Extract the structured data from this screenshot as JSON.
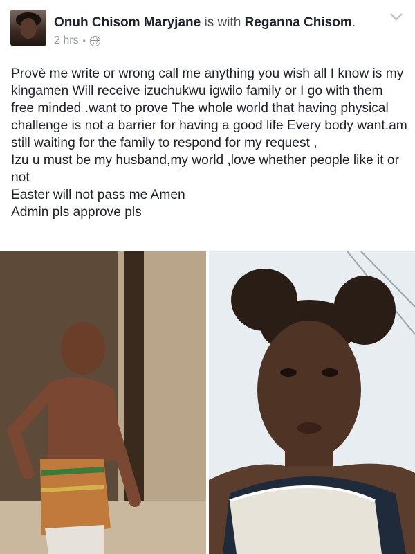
{
  "post": {
    "author": "Onuh Chisom Maryjane",
    "with_word": "is with",
    "tagged": "Reganna Chisom",
    "period": ".",
    "time": "2 hrs",
    "separator": "•",
    "privacy_icon": "globe-icon",
    "menu_icon": "chevron-down-icon",
    "lines": [
      "Provè me write or wrong call me anything you wish all I know is my kingamen Will receive izuchukwu igwilo  family or I go with them free minded .want to prove The whole world that having physical challenge is not a barrier for having a good life Every body want.am still waiting  for  the family  to respond  for  my request ,",
      "Izu u must  be my husband,my world ,love whether  people  like it or not",
      "Easter  will  not pass me Amen",
      "Admin  pls approve pls"
    ]
  },
  "photos": {
    "left_icon": "photo-man-standing",
    "right_icon": "photo-woman-selfie"
  }
}
